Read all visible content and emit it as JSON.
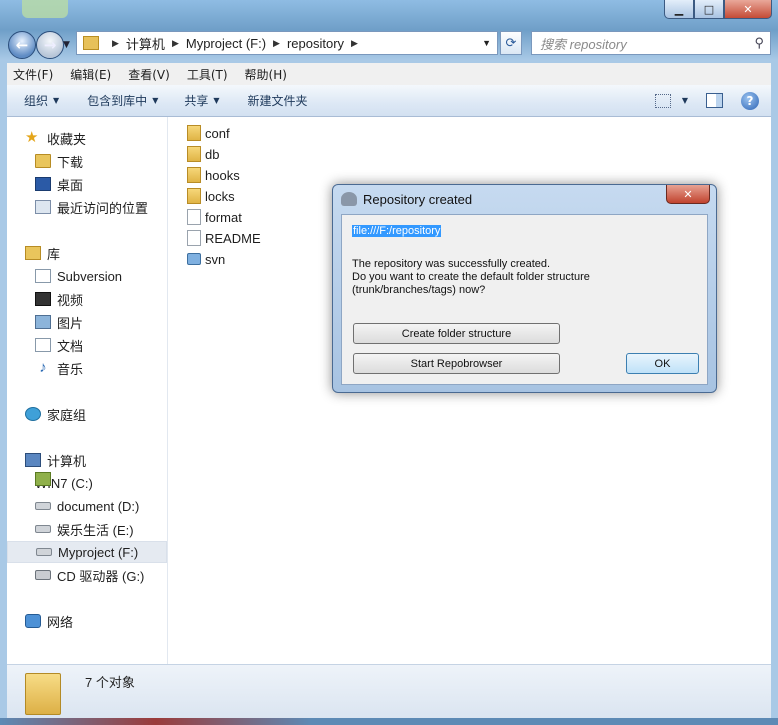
{
  "window": {
    "caption_buttons": [
      "minimize",
      "maximize",
      "close"
    ]
  },
  "address_bar": {
    "crumbs": [
      "计算机",
      "Myproject (F:)",
      "repository"
    ]
  },
  "search": {
    "placeholder": "搜索 repository"
  },
  "menu": [
    "文件(F)",
    "编辑(E)",
    "查看(V)",
    "工具(T)",
    "帮助(H)"
  ],
  "toolbar": {
    "organize": "组织",
    "include_in_library": "包含到库中",
    "share": "共享",
    "new_folder": "新建文件夹"
  },
  "nav": {
    "favorites": {
      "label": "收藏夹",
      "items": [
        "下载",
        "桌面",
        "最近访问的位置"
      ]
    },
    "libraries": {
      "label": "库",
      "items": [
        "Subversion",
        "视频",
        "图片",
        "文档",
        "音乐"
      ]
    },
    "homegroup": "家庭组",
    "computer": {
      "label": "计算机",
      "items": [
        "WIN7 (C:)",
        "document (D:)",
        "娱乐生活  (E:)",
        "Myproject (F:)",
        "CD 驱动器 (G:)"
      ]
    },
    "network": "网络"
  },
  "files": [
    {
      "name": "conf",
      "icon": "folder-icon"
    },
    {
      "name": "db",
      "icon": "folder-icon"
    },
    {
      "name": "hooks",
      "icon": "folder-icon"
    },
    {
      "name": "locks",
      "icon": "folder-icon"
    },
    {
      "name": "format",
      "icon": "file-icon"
    },
    {
      "name": "README",
      "icon": "file-icon"
    },
    {
      "name": "svn",
      "icon": "svn-icon"
    }
  ],
  "status": {
    "count": "7 个对象"
  },
  "dialog": {
    "title": "Repository created",
    "url": "file:///F:/repository",
    "message_line1": "The repository was successfully created.",
    "message_line2": "Do you want to create the default folder structure",
    "message_line3": "(trunk/branches/tags) now?",
    "create_button": "Create folder structure",
    "repobrowser_button": "Start Repobrowser",
    "ok_button": "OK"
  }
}
